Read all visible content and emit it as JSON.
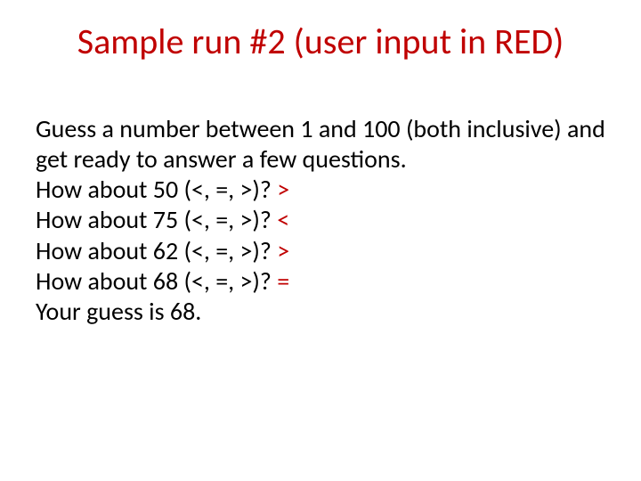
{
  "title": "Sample run #2 (user input in RED)",
  "intro": "Guess a number between 1 and 100 (both inclusive) and get ready to answer a few questions.",
  "prompts": [
    {
      "q": "How about 50 (<, =, >)? ",
      "a": ">"
    },
    {
      "q": "How about 75 (<, =, >)? ",
      "a": "<"
    },
    {
      "q": "How about 62 (<, =, >)? ",
      "a": ">"
    },
    {
      "q": "How about 68 (<, =, >)? ",
      "a": "="
    }
  ],
  "result": "Your guess is 68."
}
